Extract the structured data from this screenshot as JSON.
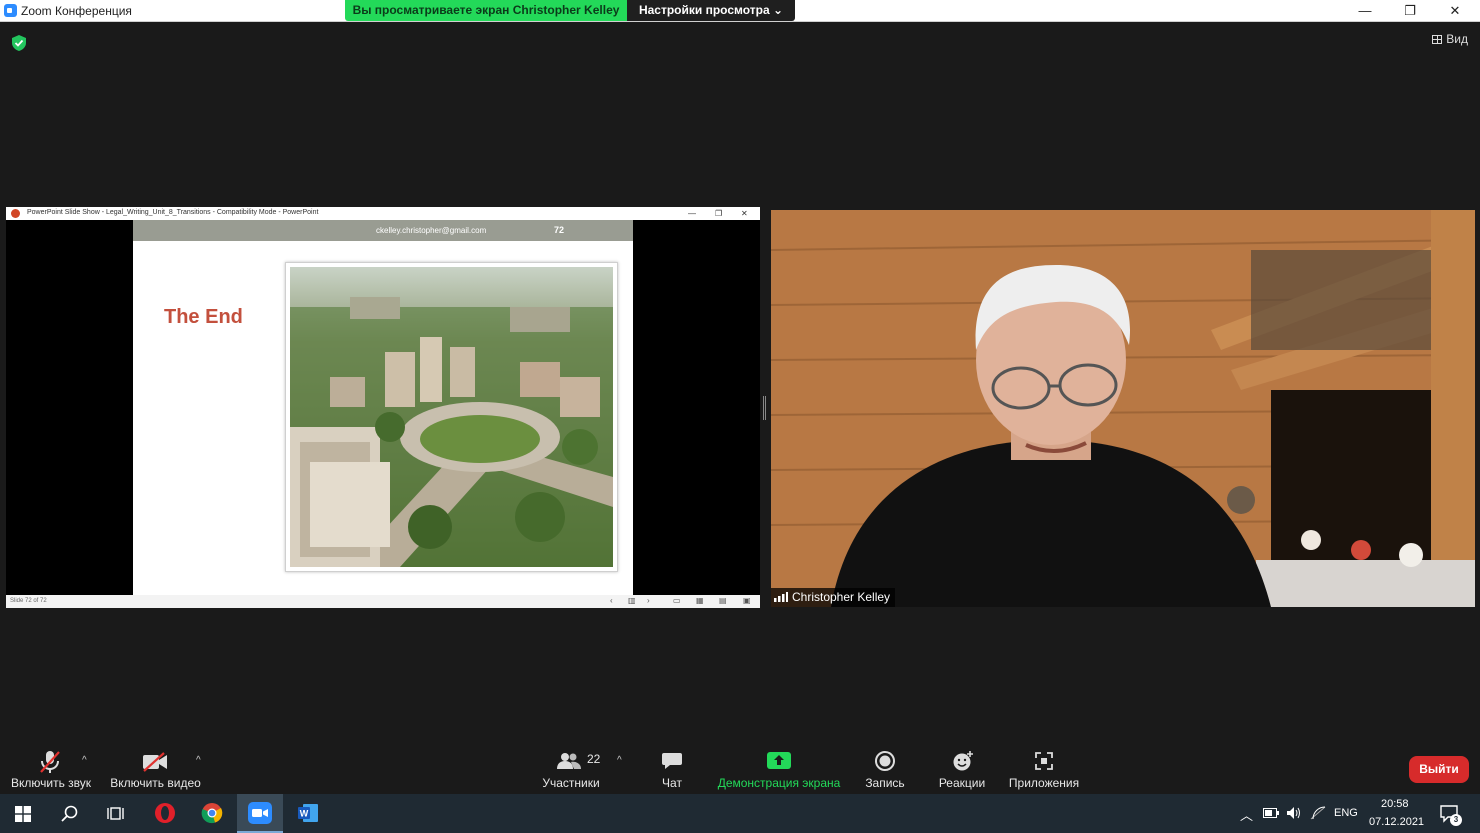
{
  "window": {
    "title": "Zoom Конференция",
    "minimize": "—",
    "restore": "❐",
    "close": "✕"
  },
  "banner": {
    "sharing_text": "Вы просматриваете экран Christopher Kelley",
    "view_settings": "Настройки просмотра ⌄"
  },
  "top_right": {
    "view_label": "Вид"
  },
  "shared_screen": {
    "ppt_title": "PowerPoint Slide Show  -  Legal_Writing_Unit_8_Transitions  -  Compatibility Mode - PowerPoint",
    "slide": {
      "email": "ckelley.christopher@gmail.com",
      "number": "72",
      "heading": "The End"
    },
    "status": "Slide 72 of 72"
  },
  "participant": {
    "name": "Christopher Kelley"
  },
  "toolbar": {
    "mute_label": "Включить звук",
    "video_label": "Включить видео",
    "participants_label": "Участники",
    "participants_count": "22",
    "chat_label": "Чат",
    "share_label": "Демонстрация экрана",
    "record_label": "Запись",
    "reactions_label": "Реакции",
    "apps_label": "Приложения",
    "leave_label": "Выйти"
  },
  "taskbar": {
    "language": "ENG",
    "time": "20:58",
    "date": "07.12.2021",
    "notifications": "3"
  },
  "colors": {
    "share_green": "#23d959",
    "leave_red": "#d72b2b",
    "ppt_heading": "#c3503d"
  }
}
